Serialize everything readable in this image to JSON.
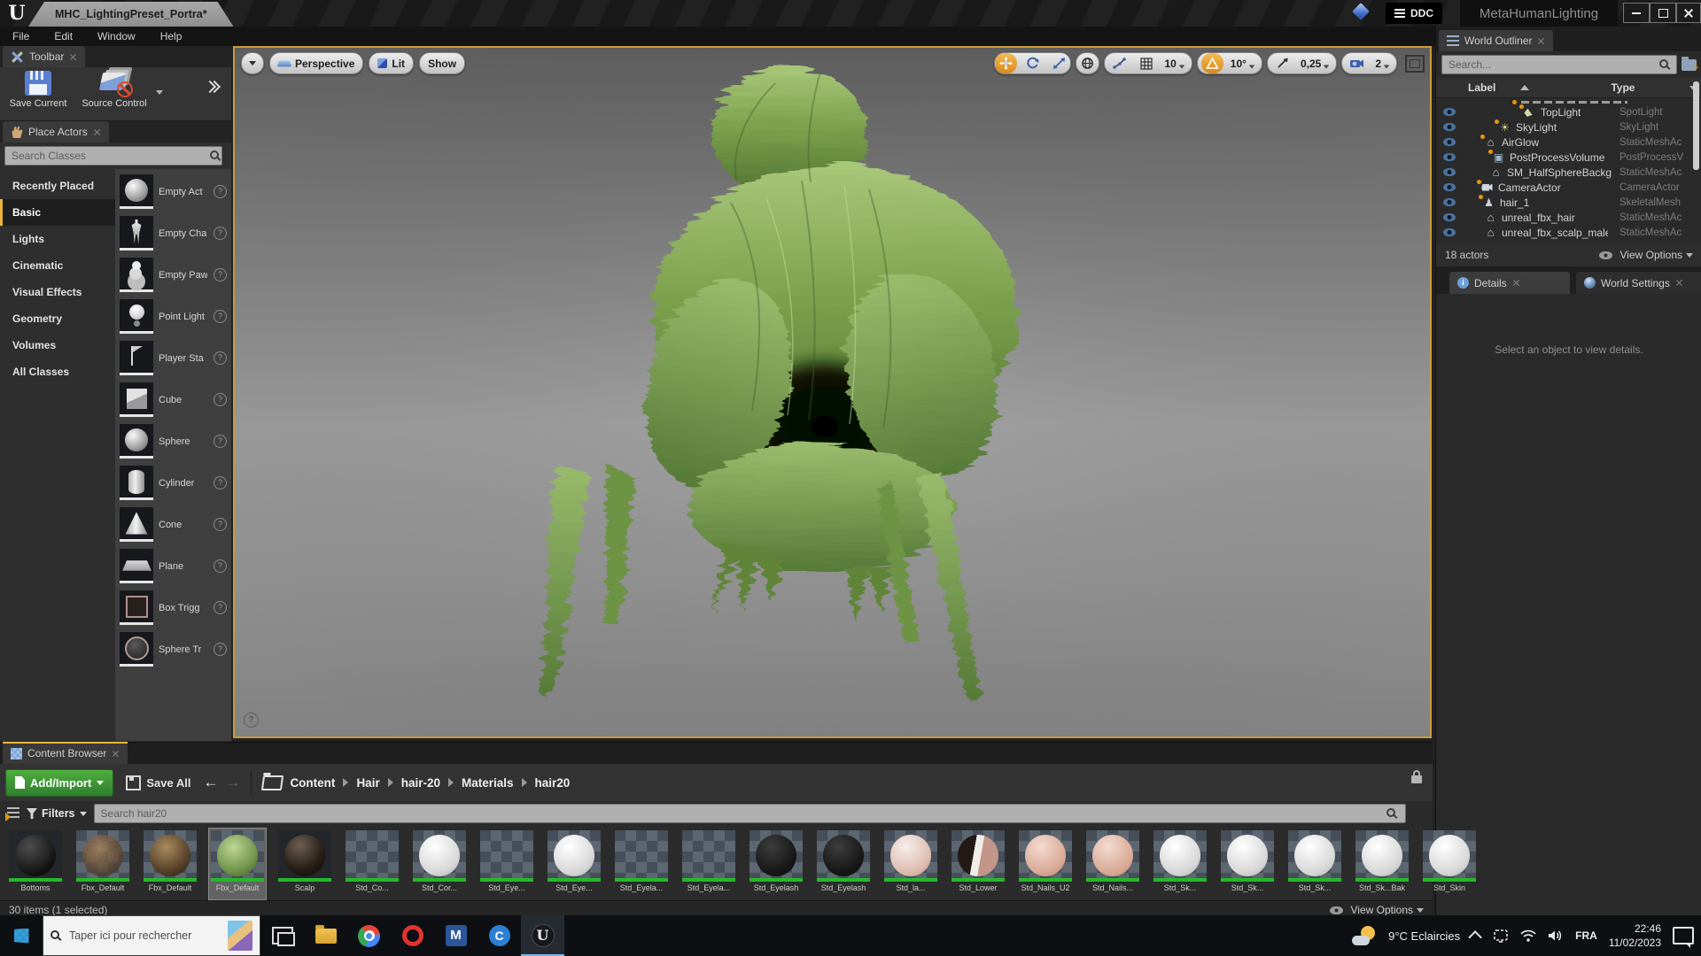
{
  "colors": {
    "accent_orange": "#d8891c",
    "selection_yellow": "#e8b43a",
    "add_green": "#3f9b3c",
    "viewport_border": "#c89c3a",
    "thumb_strip_green": "#27b82d"
  },
  "window": {
    "doc_tab": "MHC_LightingPreset_Portra*",
    "ddc": "DDC",
    "app_title": "MetaHumanLighting"
  },
  "menu": {
    "items": [
      "File",
      "Edit",
      "Window",
      "Help"
    ]
  },
  "toolbar": {
    "tab": "Toolbar",
    "save": "Save Current",
    "source_control": "Source Control"
  },
  "place_actors": {
    "tab": "Place Actors",
    "search_placeholder": "Search Classes",
    "categories": [
      {
        "label": "Recently Placed"
      },
      {
        "label": "Basic",
        "selected": true
      },
      {
        "label": "Lights"
      },
      {
        "label": "Cinematic"
      },
      {
        "label": "Visual Effects"
      },
      {
        "label": "Geometry"
      },
      {
        "label": "Volumes"
      },
      {
        "label": "All Classes"
      }
    ],
    "items": [
      {
        "label": "Empty Act",
        "icon": "sphere"
      },
      {
        "label": "Empty Cha",
        "icon": "figure"
      },
      {
        "label": "Empty Paw",
        "icon": "pawn"
      },
      {
        "label": "Point Light",
        "icon": "bulb"
      },
      {
        "label": "Player Sta",
        "icon": "flag"
      },
      {
        "label": "Cube",
        "icon": "cube"
      },
      {
        "label": "Sphere",
        "icon": "sphere"
      },
      {
        "label": "Cylinder",
        "icon": "cylinder"
      },
      {
        "label": "Cone",
        "icon": "cone"
      },
      {
        "label": "Plane",
        "icon": "plane"
      },
      {
        "label": "Box Trigg",
        "icon": "boxtrig"
      },
      {
        "label": "Sphere Tr",
        "icon": "spheretrig"
      }
    ]
  },
  "viewport": {
    "perspective": "Perspective",
    "lit": "Lit",
    "show": "Show",
    "grid_size": "10",
    "angle_snap": "10°",
    "scale_snap": "0,25",
    "camera_speed": "2"
  },
  "outliner": {
    "tab": "World Outliner",
    "search_placeholder": "Search...",
    "col_label": "Label",
    "col_type": "Type",
    "rows": [
      {
        "label": "TopLight",
        "type": "SpotLight",
        "icon": "spotlight",
        "ind": 76,
        "dot": true
      },
      {
        "label": "SkyLight",
        "type": "SkyLight",
        "icon": "skylight",
        "ind": 48,
        "dot": true
      },
      {
        "label": "AirGlow",
        "type": "StaticMeshAc",
        "icon": "house",
        "ind": 32,
        "dot": true
      },
      {
        "label": "PostProcessVolume",
        "type": "PostProcessV",
        "icon": "volume",
        "ind": 41,
        "dot": true
      },
      {
        "label": "SM_HalfSphereBackg",
        "type": "StaticMeshAc",
        "icon": "house",
        "ind": 38
      },
      {
        "label": "CameraActor",
        "type": "CameraActor",
        "icon": "camera",
        "ind": 28,
        "dot": true
      },
      {
        "label": "hair_1",
        "type": "SkeletalMesh",
        "icon": "person",
        "ind": 30,
        "dot": true
      },
      {
        "label": "unreal_fbx_hair",
        "type": "StaticMeshAc",
        "icon": "house",
        "ind": 32
      },
      {
        "label": "unreal_fbx_scalp_male",
        "type": "StaticMeshAc",
        "icon": "house",
        "ind": 32
      }
    ],
    "status": "18 actors",
    "view_options": "View Options"
  },
  "details": {
    "tab_details": "Details",
    "tab_world": "World Settings",
    "empty": "Select an object to view details."
  },
  "content_browser": {
    "tab": "Content Browser",
    "add_import": "Add/Import",
    "save_all": "Save All",
    "breadcrumbs": [
      "Content",
      "Hair",
      "hair-20",
      "Materials",
      "hair20"
    ],
    "filters": "Filters",
    "search_placeholder": "Search hair20",
    "assets": [
      {
        "label": "Bottoms",
        "thumb": "black"
      },
      {
        "label": "Fbx_Default",
        "thumb": "hair-sparse"
      },
      {
        "label": "Fbx_Default",
        "thumb": "hair-brown"
      },
      {
        "label": "Fbx_Default",
        "thumb": "hair-green",
        "selected": true
      },
      {
        "label": "Scalp",
        "thumb": "scalp"
      },
      {
        "label": "Std_Co...",
        "thumb": "checker"
      },
      {
        "label": "Std_Cor...",
        "thumb": "white"
      },
      {
        "label": "Std_Eye...",
        "thumb": "checker"
      },
      {
        "label": "Std_Eye...",
        "thumb": "white"
      },
      {
        "label": "Std_Eyela...",
        "thumb": "checker"
      },
      {
        "label": "Std_Eyela...",
        "thumb": "checker"
      },
      {
        "label": "Std_Eyelash",
        "thumb": "lash"
      },
      {
        "label": "Std_Eyelash",
        "thumb": "lash"
      },
      {
        "label": "Std_la...",
        "thumb": "skin-light"
      },
      {
        "label": "Std_Lower",
        "thumb": "stripe"
      },
      {
        "label": "Std_Nails_U2",
        "thumb": "skin-pink"
      },
      {
        "label": "Std_Nails...",
        "thumb": "skin-pink"
      },
      {
        "label": "Std_Sk...",
        "thumb": "white"
      },
      {
        "label": "Std_Sk...",
        "thumb": "white"
      },
      {
        "label": "Std_Sk...",
        "thumb": "white"
      },
      {
        "label": "Std_Sk...Bak",
        "thumb": "white"
      },
      {
        "label": "Std_Skin",
        "thumb": "white"
      }
    ],
    "status": "30 items (1 selected)",
    "view_options": "View Options"
  },
  "taskbar": {
    "search_placeholder": "Taper ici pour rechercher",
    "weather": "9°C Eclaircies",
    "lang": "FRA",
    "time": "22:46",
    "date": "11/02/2023"
  }
}
